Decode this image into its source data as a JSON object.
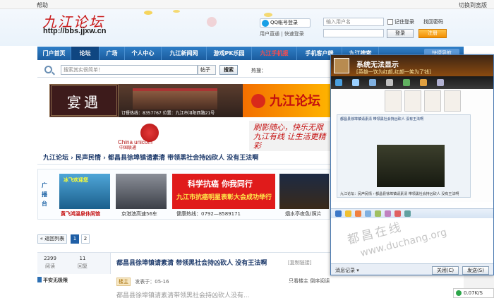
{
  "topbar": {
    "help": "帮助",
    "switch_width": "切换到宽版"
  },
  "header": {
    "logo_text": "九江论坛",
    "logo_url": "http://bbs.jjxw.cn",
    "qq_login": "QQ帐号登录",
    "quick_links": "用户直通 | 快速登录",
    "username_placeholder": "输入用户名",
    "remember": "记住登录",
    "find_password": "找回密码",
    "login": "登录",
    "register": "注册"
  },
  "nav": {
    "items": [
      "门户首页",
      "论坛",
      "广场",
      "个人中心",
      "九江新闻网",
      "游戏PK乐园",
      "九江手机报",
      "手机客户端",
      "九江搜索"
    ],
    "right_button": "快捷导航"
  },
  "search": {
    "placeholder": "搜索其实很简单！",
    "type": "帖子",
    "button": "搜索",
    "hot": "热搜："
  },
  "banner1": {
    "left_text": "宴遇",
    "caption": "订餐热线：8357767   位置：九江市浔阳西路21号",
    "right_text": "九江论坛"
  },
  "banner2": {
    "brand_cn": "中国联通",
    "brand_en": "China unicom",
    "slogan": "刷影随心，快乐无限\n九江有线 让生活更精彩"
  },
  "breadcrumb": {
    "home": "九江论坛",
    "section": "民声民情",
    "title": "都昌县徐埠镇请素清 带领黑社会持凶砍人 没有王法啊"
  },
  "adstrip": {
    "label": "广播台",
    "items": [
      {
        "caption": "黄飞鸿温泉休闲馆",
        "badge": "冰飞欢迎您"
      },
      {
        "caption": "京港澳高速56车"
      },
      {
        "caption": "健康热线：0792—8589171",
        "banner": "科学抗癌 你我同行",
        "banner2": "九江市抗癌明星表彰大会成功举行"
      },
      {
        "caption": "烟水亭夜色(照片"
      }
    ]
  },
  "pager": {
    "back": "« 返回列表",
    "pages": [
      "1",
      "2"
    ]
  },
  "thread": {
    "views": "2399",
    "views_label": "阅读",
    "replies": "11",
    "replies_label": "回复",
    "title": "都昌县徐埠镇请素清 带领黑社会持凶砍人 没有王法啊",
    "copy_link": "[复制链接]",
    "author": "平安无极限",
    "role": "楼主",
    "posted": "发表于：05-16",
    "only_author": "只看楼主  倒序阅读",
    "body": "都昌县徐埠镇请素清带领黑社会持凶砍人没有..."
  },
  "qq_window": {
    "title": "系统无法显示",
    "signature": "[英雄一饮为红颜,红颜一笑为了钱]",
    "preview_title": "都昌县徐埠镇请素清 带领黑社会持凶砍人 没有王法啊",
    "preview_footer": "九江论坛：民声民情 › 都昌县徐埠镇请素清 带领黑社会持凶砍人 没有王法啊",
    "watermark": "都昌在线",
    "watermark_url": "www.duchang.org",
    "msg_record": "消息记录 ▾",
    "close": "关闭(C)",
    "send": "发送(S)"
  },
  "status_corner": {
    "text": "0.07K/S"
  }
}
